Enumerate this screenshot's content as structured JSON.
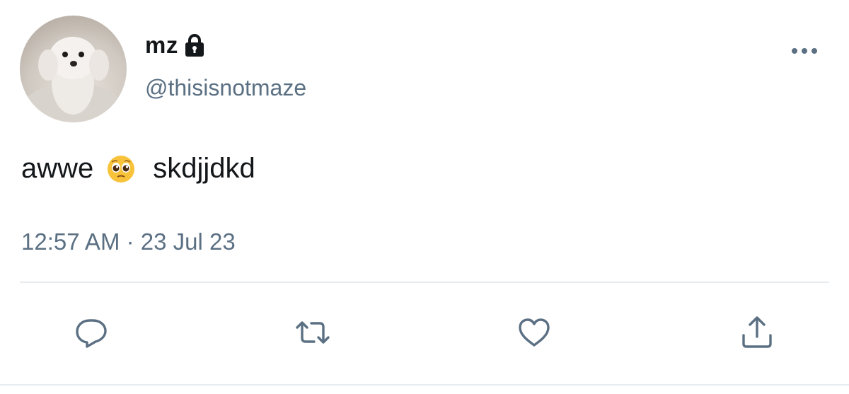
{
  "user": {
    "display_name": "mz",
    "handle": "@thisisnotmaze",
    "protected": true
  },
  "tweet": {
    "text_before_emoji": "awwe",
    "emoji": "pleading-face",
    "text_after_emoji": "skdjjdkd",
    "timestamp": "12:57 AM · 23 Jul 23"
  },
  "actions": {
    "reply_icon": "reply-icon",
    "retweet_icon": "retweet-icon",
    "like_icon": "heart-icon",
    "share_icon": "share-icon"
  },
  "colors": {
    "text_primary": "#14171a",
    "text_secondary": "#5b7083",
    "icon": "#5b7083",
    "divider": "#e6ecf0"
  }
}
